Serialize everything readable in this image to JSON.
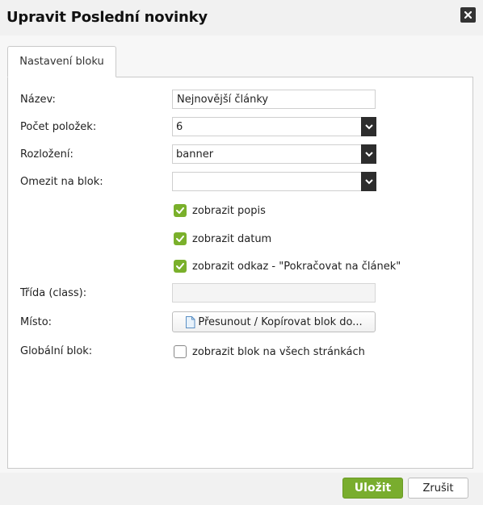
{
  "dialog": {
    "title": "Upravit Poslední novinky",
    "close_icon": "close-icon"
  },
  "tabs": [
    {
      "label": "Nastavení bloku",
      "active": true
    }
  ],
  "form": {
    "name": {
      "label": "Název:",
      "value": "Nejnovější články"
    },
    "item_count": {
      "label": "Počet položek:",
      "value": "6"
    },
    "layout": {
      "label": "Rozložení:",
      "value": "banner"
    },
    "limit_to_block": {
      "label": "Omezit na blok:",
      "value": ""
    },
    "checkboxes": [
      {
        "label": "zobrazit popis",
        "checked": true
      },
      {
        "label": "zobrazit datum",
        "checked": true
      },
      {
        "label": "zobrazit odkaz - \"Pokračovat na článek\"",
        "checked": true
      }
    ],
    "class_field": {
      "label": "Třída (class):",
      "value": ""
    },
    "location": {
      "label": "Místo:",
      "button_label": "Přesunout / Kopírovat blok do...",
      "button_icon": "document-icon"
    },
    "global_block": {
      "label": "Globální blok:",
      "checkbox_label": "zobrazit blok na všech stránkách",
      "checked": false
    }
  },
  "footer": {
    "save_label": "Uložit",
    "cancel_label": "Zrušit"
  },
  "colors": {
    "accent_green": "#79ad2e",
    "dark_control": "#2d2d2d"
  }
}
